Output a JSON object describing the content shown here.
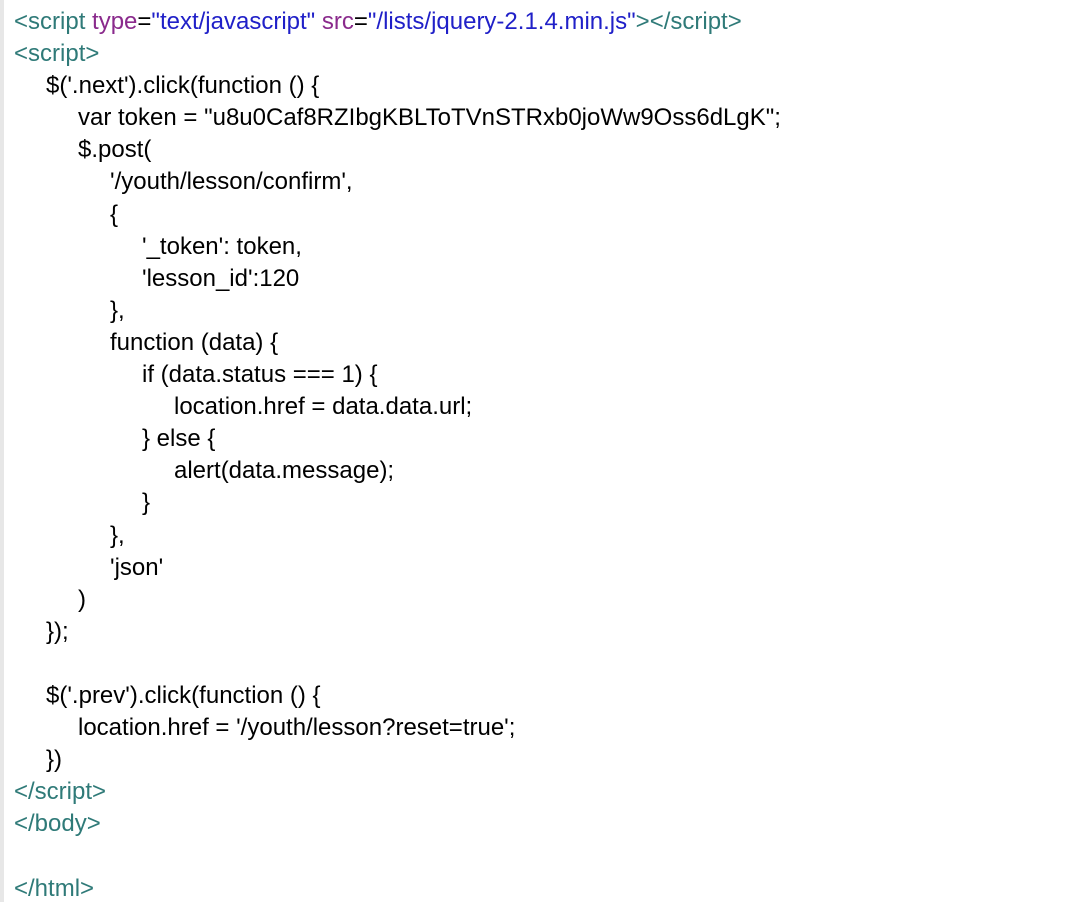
{
  "source": {
    "script_open_tag": "script",
    "script_type_attr": "type",
    "script_type_value": "\"text/javascript\"",
    "script_src_attr": "src",
    "script_src_value": "\"/lists/jquery-2.1.4.min.js\"",
    "script_close_tag": "/script",
    "body_close_tag": "/body",
    "html_close_tag": "/html",
    "js_lines": [
      "$('.next').click(function () {",
      "var token = \"u8u0Caf8RZIbgKBLToTVnSTRxb0joWw9Oss6dLgK\";",
      "$.post(",
      "'/youth/lesson/confirm',",
      "{",
      "'_token': token,",
      "'lesson_id':120",
      "},",
      "function (data) {",
      "if (data.status === 1) {",
      "location.href = data.data.url;",
      "} else {",
      "alert(data.message);",
      "}",
      "},",
      "'json'",
      ")",
      "});",
      "$('.prev').click(function () {",
      "location.href = '/youth/lesson?reset=true';",
      "})"
    ]
  }
}
